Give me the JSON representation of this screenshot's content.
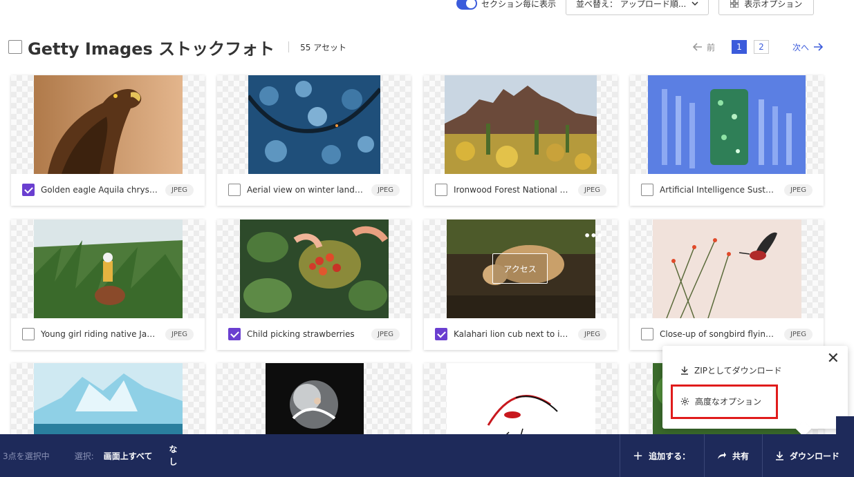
{
  "top_controls": {
    "section_toggle_label": "セクション毎に表示",
    "sort_label": "並べ替え： アップロード順...",
    "view_options_label": "表示オプション"
  },
  "header": {
    "title": "Getty Images ストックフォト",
    "asset_count": "55 アセット",
    "prev_label": "前",
    "pages": [
      "1",
      "2"
    ],
    "current_page": "1",
    "next_label": "次へ"
  },
  "assets": [
    {
      "name": "Golden eagle Aquila chrysa...",
      "format": "JPEG",
      "checked": true
    },
    {
      "name": "Aerial view on winter landsc...",
      "format": "JPEG",
      "checked": false
    },
    {
      "name": "Ironwood Forest National M...",
      "format": "JPEG",
      "checked": false
    },
    {
      "name": "Artificial Intelligence Sustai...",
      "format": "JPEG",
      "checked": false
    },
    {
      "name": "Young girl riding native Jap...",
      "format": "JPEG",
      "checked": false
    },
    {
      "name": "Child picking strawberries",
      "format": "JPEG",
      "checked": true
    },
    {
      "name": "Kalahari lion cub next to its ...",
      "format": "JPEG",
      "checked": true
    },
    {
      "name": "Close-up of songbird flying ...",
      "format": "JPEG",
      "checked": false
    }
  ],
  "hover_overlay": {
    "access_label": "アクセス"
  },
  "bottom_bar": {
    "selected_count": "3点を選択中",
    "select_label": "選択:",
    "select_all": "画面上すべて",
    "select_none": "なし",
    "add_label": "追加する：",
    "share_label": "共有",
    "download_label": "ダウンロード"
  },
  "download_popup": {
    "zip_label": "ZIPとしてダウンロード",
    "advanced_label": "高度なオプション"
  },
  "colors": {
    "accent": "#3b5bdb",
    "checkbox": "#6a3fd0",
    "bar": "#1e2a5a",
    "highlight": "#e01b1b"
  }
}
